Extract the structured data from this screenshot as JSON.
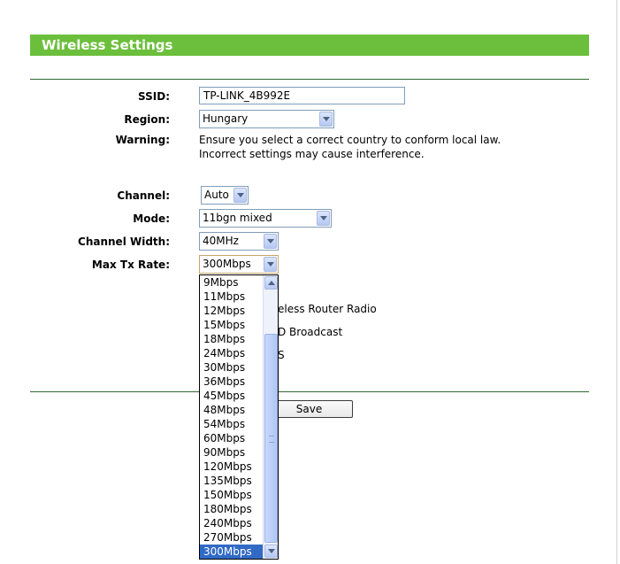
{
  "header": {
    "title": "Wireless Settings"
  },
  "form": {
    "ssid_label": "SSID:",
    "ssid_value": "TP-LINK_4B992E",
    "region_label": "Region:",
    "region_value": "Hungary",
    "warning_label": "Warning:",
    "warning_line1": "Ensure you select a correct country to conform local law.",
    "warning_line2": "Incorrect settings may cause interference.",
    "channel_label": "Channel:",
    "channel_value": "Auto",
    "mode_label": "Mode:",
    "mode_value": "11bgn mixed",
    "width_label": "Channel Width:",
    "width_value": "40MHz",
    "rate_label": "Max Tx Rate:",
    "rate_value": "300Mbps",
    "covered_radio": "eless Router Radio",
    "covered_broadcast": "D Broadcast",
    "covered_wds": "S",
    "save_label": "Save"
  },
  "dropdown": {
    "options": [
      "9Mbps",
      "11Mbps",
      "12Mbps",
      "15Mbps",
      "18Mbps",
      "24Mbps",
      "30Mbps",
      "36Mbps",
      "45Mbps",
      "48Mbps",
      "54Mbps",
      "60Mbps",
      "90Mbps",
      "120Mbps",
      "135Mbps",
      "150Mbps",
      "180Mbps",
      "240Mbps",
      "270Mbps",
      "300Mbps"
    ],
    "selected": "300Mbps"
  },
  "colors": {
    "header_bg": "#6cbf3c",
    "divider": "#2e6b2e",
    "selection": "#316ac5"
  }
}
